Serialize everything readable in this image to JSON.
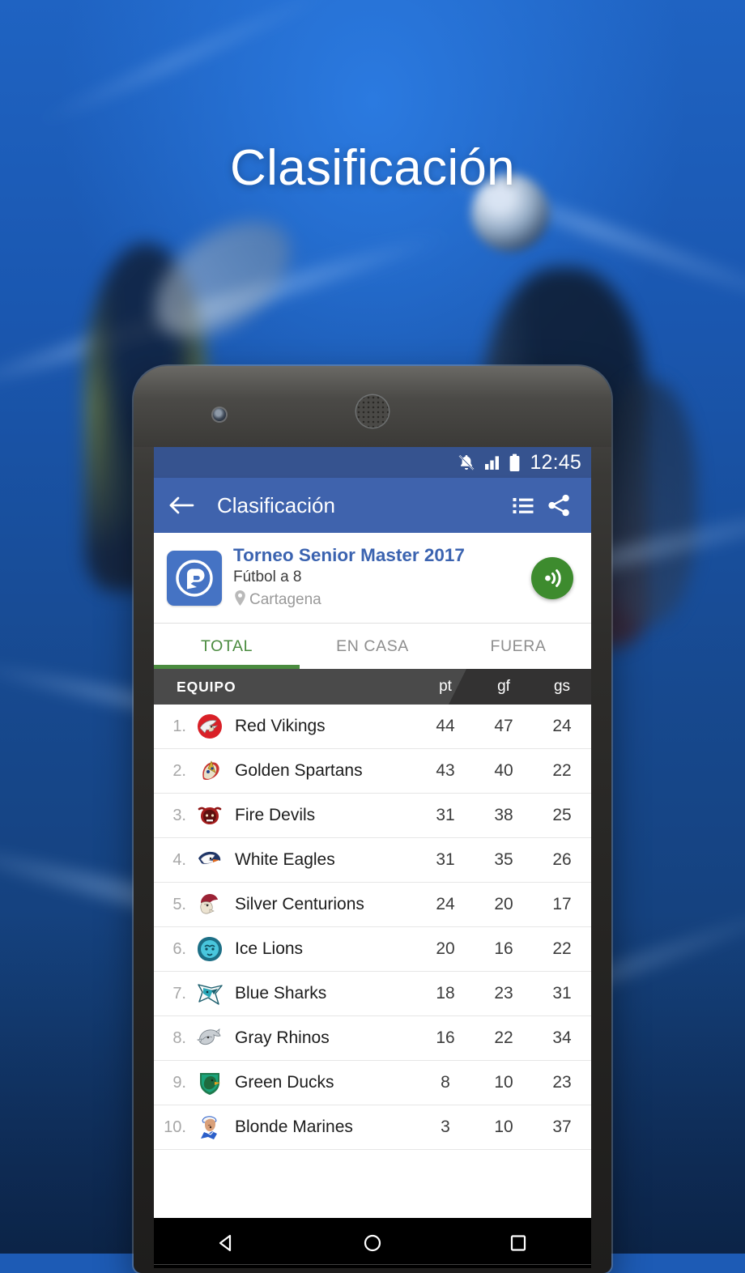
{
  "hero": {
    "title": "Clasificación"
  },
  "status_bar": {
    "time": "12:45",
    "icons": [
      "bell-muted-icon",
      "signal-bars-icon",
      "battery-icon"
    ]
  },
  "app_bar": {
    "back_icon": "arrow-back-icon",
    "title": "Clasificación",
    "actions": [
      {
        "icon": "list-icon",
        "name": "list-view-button"
      },
      {
        "icon": "share-icon",
        "name": "share-button"
      }
    ]
  },
  "tournament": {
    "logo_icon": "tournament-logo-icon",
    "name": "Torneo Senior Master 2017",
    "sport": "Fútbol a 8",
    "location_icon": "map-pin-icon",
    "location": "Cartagena",
    "follow_icon": "broadcast-icon"
  },
  "tabs": [
    {
      "label": "TOTAL",
      "active": true
    },
    {
      "label": "EN CASA",
      "active": false
    },
    {
      "label": "FUERA",
      "active": false
    }
  ],
  "table": {
    "columns": [
      "EQUIPO",
      "pt",
      "gf",
      "gs"
    ],
    "rows": [
      {
        "pos": "1.",
        "team": "Red Vikings",
        "crest": "viking-crest",
        "pt": "44",
        "gf": "47",
        "gs": "24"
      },
      {
        "pos": "2.",
        "team": "Golden Spartans",
        "crest": "spartan-crest",
        "pt": "43",
        "gf": "40",
        "gs": "22"
      },
      {
        "pos": "3.",
        "team": "Fire Devils",
        "crest": "devil-crest",
        "pt": "31",
        "gf": "38",
        "gs": "25"
      },
      {
        "pos": "4.",
        "team": "White Eagles",
        "crest": "eagle-crest",
        "pt": "31",
        "gf": "35",
        "gs": "26"
      },
      {
        "pos": "5.",
        "team": "Silver Centurions",
        "crest": "centurion-crest",
        "pt": "24",
        "gf": "20",
        "gs": "17"
      },
      {
        "pos": "6.",
        "team": "Ice Lions",
        "crest": "lion-crest",
        "pt": "20",
        "gf": "16",
        "gs": "22"
      },
      {
        "pos": "7.",
        "team": "Blue Sharks",
        "crest": "shark-crest",
        "pt": "18",
        "gf": "23",
        "gs": "31"
      },
      {
        "pos": "8.",
        "team": "Gray Rhinos",
        "crest": "rhino-crest",
        "pt": "16",
        "gf": "22",
        "gs": "34"
      },
      {
        "pos": "9.",
        "team": "Green Ducks",
        "crest": "duck-crest",
        "pt": "8",
        "gf": "10",
        "gs": "23"
      },
      {
        "pos": "10.",
        "team": "Blonde Marines",
        "crest": "marine-crest",
        "pt": "3",
        "gf": "10",
        "gs": "37"
      }
    ]
  },
  "nav_bar": [
    {
      "name": "nav-back-button",
      "icon": "triangle-back-icon"
    },
    {
      "name": "nav-home-button",
      "icon": "circle-home-icon"
    },
    {
      "name": "nav-recents-button",
      "icon": "square-recents-icon"
    }
  ],
  "colors": {
    "app_bar_blue": "#3f63ad",
    "status_bar_blue": "#36538f",
    "accent_green": "#4a8b3f",
    "fab_green": "#3d8b2e",
    "table_header_dark": "#4a4a4a",
    "tournament_name_blue": "#3b63b0",
    "background_blue": "#1a57b0"
  }
}
